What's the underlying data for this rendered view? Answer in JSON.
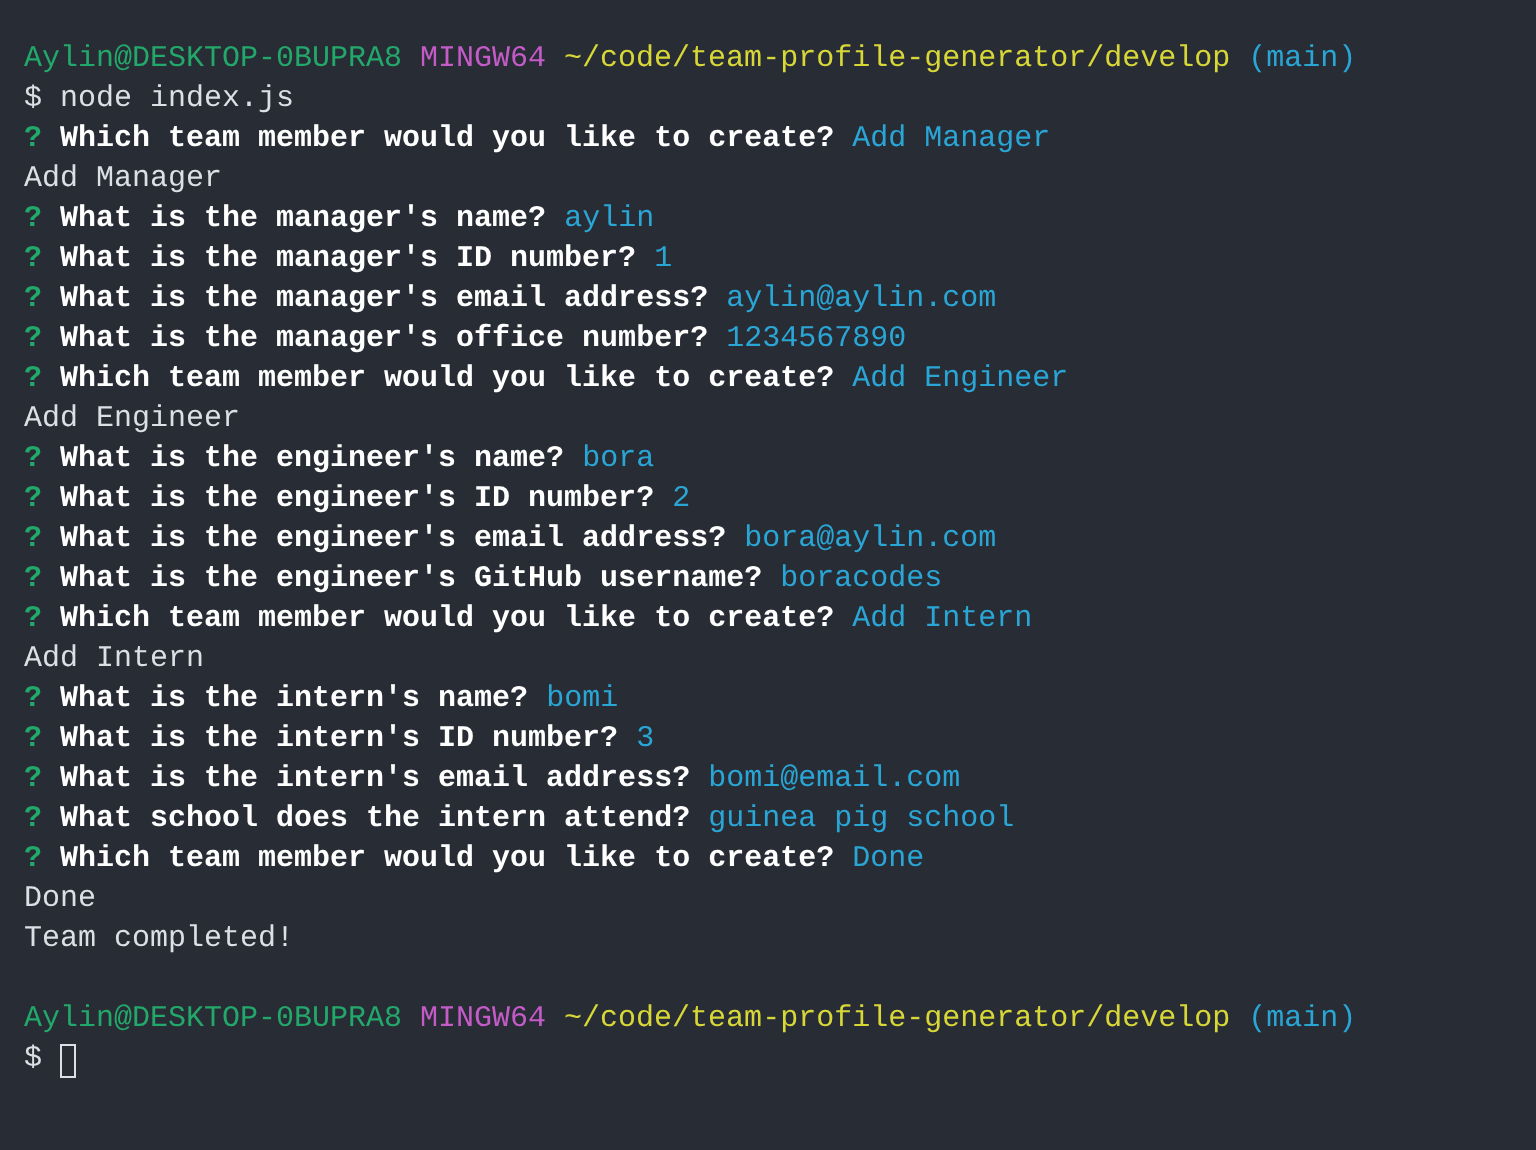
{
  "terminal": {
    "lines": [
      {
        "kind": "prompt",
        "user": "Aylin@DESKTOP-0BUPRA8",
        "system": "MINGW64",
        "path": "~/code/team-profile-generator/develop",
        "branch": "(main)"
      },
      {
        "kind": "command",
        "symbol": "$",
        "text": "node index.js"
      },
      {
        "kind": "question",
        "mark": "?",
        "text": "Which team member would you like to create?",
        "answer": "Add Manager"
      },
      {
        "kind": "output",
        "text": "Add Manager"
      },
      {
        "kind": "question",
        "mark": "?",
        "text": "What is the manager's name?",
        "answer": "aylin"
      },
      {
        "kind": "question",
        "mark": "?",
        "text": "What is the manager's ID number?",
        "answer": "1"
      },
      {
        "kind": "question",
        "mark": "?",
        "text": "What is the manager's email address?",
        "answer": "aylin@aylin.com"
      },
      {
        "kind": "question",
        "mark": "?",
        "text": "What is the manager's office number?",
        "answer": "1234567890"
      },
      {
        "kind": "question",
        "mark": "?",
        "text": "Which team member would you like to create?",
        "answer": "Add Engineer"
      },
      {
        "kind": "output",
        "text": "Add Engineer"
      },
      {
        "kind": "question",
        "mark": "?",
        "text": "What is the engineer's name?",
        "answer": "bora"
      },
      {
        "kind": "question",
        "mark": "?",
        "text": "What is the engineer's ID number?",
        "answer": "2"
      },
      {
        "kind": "question",
        "mark": "?",
        "text": "What is the engineer's email address?",
        "answer": "bora@aylin.com"
      },
      {
        "kind": "question",
        "mark": "?",
        "text": "What is the engineer's GitHub username?",
        "answer": "boracodes"
      },
      {
        "kind": "question",
        "mark": "?",
        "text": "Which team member would you like to create?",
        "answer": "Add Intern"
      },
      {
        "kind": "output",
        "text": "Add Intern"
      },
      {
        "kind": "question",
        "mark": "?",
        "text": "What is the intern's name?",
        "answer": "bomi"
      },
      {
        "kind": "question",
        "mark": "?",
        "text": "What is the intern's ID number?",
        "answer": "3"
      },
      {
        "kind": "question",
        "mark": "?",
        "text": "What is the intern's email address?",
        "answer": "bomi@email.com"
      },
      {
        "kind": "question",
        "mark": "?",
        "text": "What school does the intern attend?",
        "answer": "guinea pig school"
      },
      {
        "kind": "question",
        "mark": "?",
        "text": "Which team member would you like to create?",
        "answer": "Done"
      },
      {
        "kind": "output",
        "text": "Done"
      },
      {
        "kind": "output",
        "text": "Team completed!"
      },
      {
        "kind": "blank"
      },
      {
        "kind": "prompt",
        "user": "Aylin@DESKTOP-0BUPRA8",
        "system": "MINGW64",
        "path": "~/code/team-profile-generator/develop",
        "branch": "(main)"
      },
      {
        "kind": "input",
        "symbol": "$"
      }
    ]
  }
}
